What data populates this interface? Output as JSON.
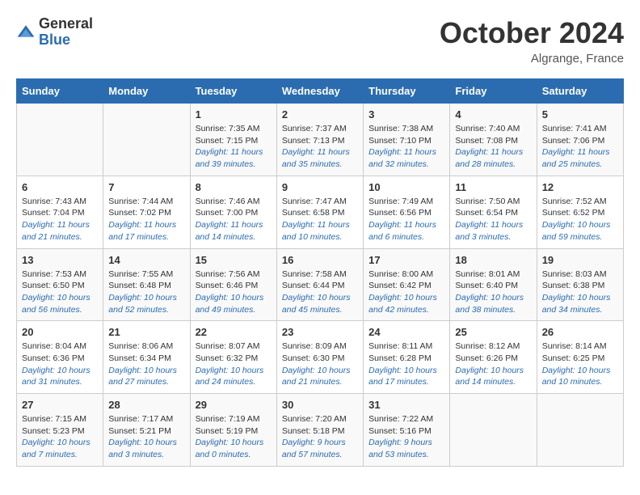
{
  "logo": {
    "general": "General",
    "blue": "Blue"
  },
  "header": {
    "month": "October 2024",
    "location": "Algrange, France"
  },
  "weekdays": [
    "Sunday",
    "Monday",
    "Tuesday",
    "Wednesday",
    "Thursday",
    "Friday",
    "Saturday"
  ],
  "weeks": [
    [
      {
        "day": "",
        "detail": ""
      },
      {
        "day": "",
        "detail": ""
      },
      {
        "day": "1",
        "detail": "Sunrise: 7:35 AM\nSunset: 7:15 PM\nDaylight: 11 hours and 39 minutes."
      },
      {
        "day": "2",
        "detail": "Sunrise: 7:37 AM\nSunset: 7:13 PM\nDaylight: 11 hours and 35 minutes."
      },
      {
        "day": "3",
        "detail": "Sunrise: 7:38 AM\nSunset: 7:10 PM\nDaylight: 11 hours and 32 minutes."
      },
      {
        "day": "4",
        "detail": "Sunrise: 7:40 AM\nSunset: 7:08 PM\nDaylight: 11 hours and 28 minutes."
      },
      {
        "day": "5",
        "detail": "Sunrise: 7:41 AM\nSunset: 7:06 PM\nDaylight: 11 hours and 25 minutes."
      }
    ],
    [
      {
        "day": "6",
        "detail": "Sunrise: 7:43 AM\nSunset: 7:04 PM\nDaylight: 11 hours and 21 minutes."
      },
      {
        "day": "7",
        "detail": "Sunrise: 7:44 AM\nSunset: 7:02 PM\nDaylight: 11 hours and 17 minutes."
      },
      {
        "day": "8",
        "detail": "Sunrise: 7:46 AM\nSunset: 7:00 PM\nDaylight: 11 hours and 14 minutes."
      },
      {
        "day": "9",
        "detail": "Sunrise: 7:47 AM\nSunset: 6:58 PM\nDaylight: 11 hours and 10 minutes."
      },
      {
        "day": "10",
        "detail": "Sunrise: 7:49 AM\nSunset: 6:56 PM\nDaylight: 11 hours and 6 minutes."
      },
      {
        "day": "11",
        "detail": "Sunrise: 7:50 AM\nSunset: 6:54 PM\nDaylight: 11 hours and 3 minutes."
      },
      {
        "day": "12",
        "detail": "Sunrise: 7:52 AM\nSunset: 6:52 PM\nDaylight: 10 hours and 59 minutes."
      }
    ],
    [
      {
        "day": "13",
        "detail": "Sunrise: 7:53 AM\nSunset: 6:50 PM\nDaylight: 10 hours and 56 minutes."
      },
      {
        "day": "14",
        "detail": "Sunrise: 7:55 AM\nSunset: 6:48 PM\nDaylight: 10 hours and 52 minutes."
      },
      {
        "day": "15",
        "detail": "Sunrise: 7:56 AM\nSunset: 6:46 PM\nDaylight: 10 hours and 49 minutes."
      },
      {
        "day": "16",
        "detail": "Sunrise: 7:58 AM\nSunset: 6:44 PM\nDaylight: 10 hours and 45 minutes."
      },
      {
        "day": "17",
        "detail": "Sunrise: 8:00 AM\nSunset: 6:42 PM\nDaylight: 10 hours and 42 minutes."
      },
      {
        "day": "18",
        "detail": "Sunrise: 8:01 AM\nSunset: 6:40 PM\nDaylight: 10 hours and 38 minutes."
      },
      {
        "day": "19",
        "detail": "Sunrise: 8:03 AM\nSunset: 6:38 PM\nDaylight: 10 hours and 34 minutes."
      }
    ],
    [
      {
        "day": "20",
        "detail": "Sunrise: 8:04 AM\nSunset: 6:36 PM\nDaylight: 10 hours and 31 minutes."
      },
      {
        "day": "21",
        "detail": "Sunrise: 8:06 AM\nSunset: 6:34 PM\nDaylight: 10 hours and 27 minutes."
      },
      {
        "day": "22",
        "detail": "Sunrise: 8:07 AM\nSunset: 6:32 PM\nDaylight: 10 hours and 24 minutes."
      },
      {
        "day": "23",
        "detail": "Sunrise: 8:09 AM\nSunset: 6:30 PM\nDaylight: 10 hours and 21 minutes."
      },
      {
        "day": "24",
        "detail": "Sunrise: 8:11 AM\nSunset: 6:28 PM\nDaylight: 10 hours and 17 minutes."
      },
      {
        "day": "25",
        "detail": "Sunrise: 8:12 AM\nSunset: 6:26 PM\nDaylight: 10 hours and 14 minutes."
      },
      {
        "day": "26",
        "detail": "Sunrise: 8:14 AM\nSunset: 6:25 PM\nDaylight: 10 hours and 10 minutes."
      }
    ],
    [
      {
        "day": "27",
        "detail": "Sunrise: 7:15 AM\nSunset: 5:23 PM\nDaylight: 10 hours and 7 minutes."
      },
      {
        "day": "28",
        "detail": "Sunrise: 7:17 AM\nSunset: 5:21 PM\nDaylight: 10 hours and 3 minutes."
      },
      {
        "day": "29",
        "detail": "Sunrise: 7:19 AM\nSunset: 5:19 PM\nDaylight: 10 hours and 0 minutes."
      },
      {
        "day": "30",
        "detail": "Sunrise: 7:20 AM\nSunset: 5:18 PM\nDaylight: 9 hours and 57 minutes."
      },
      {
        "day": "31",
        "detail": "Sunrise: 7:22 AM\nSunset: 5:16 PM\nDaylight: 9 hours and 53 minutes."
      },
      {
        "day": "",
        "detail": ""
      },
      {
        "day": "",
        "detail": ""
      }
    ]
  ]
}
